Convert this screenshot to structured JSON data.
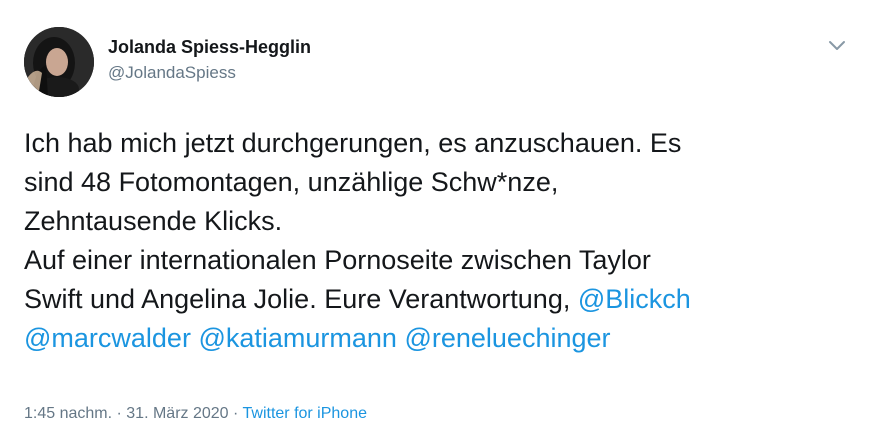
{
  "author": {
    "display_name": "Jolanda Spiess-Hegglin",
    "handle": "@JolandaSpiess"
  },
  "menu": {
    "icon": "chevron-down-icon"
  },
  "tweet": {
    "line1": "Ich hab mich jetzt durchgerungen, es anzuschauen. Es",
    "line2": "sind 48 Fotomontagen, unzählige Schw*nze,",
    "line3": "Zehntausende Klicks.",
    "line4": "Auf einer internationalen Pornoseite zwischen Taylor",
    "line5_text": "Swift und Angelina Jolie. Eure Verantwortung, ",
    "mentions": [
      "@Blickch",
      "@marcwalder",
      "@katiamurmann",
      "@reneluechinger"
    ]
  },
  "meta": {
    "time": "1:45 nachm.",
    "separator1": " · ",
    "date": "31. März 2020",
    "separator2": " · ",
    "source": "Twitter for iPhone"
  },
  "colors": {
    "link": "#1b95e0",
    "secondary_text": "#657786",
    "primary_text": "#14171a"
  }
}
